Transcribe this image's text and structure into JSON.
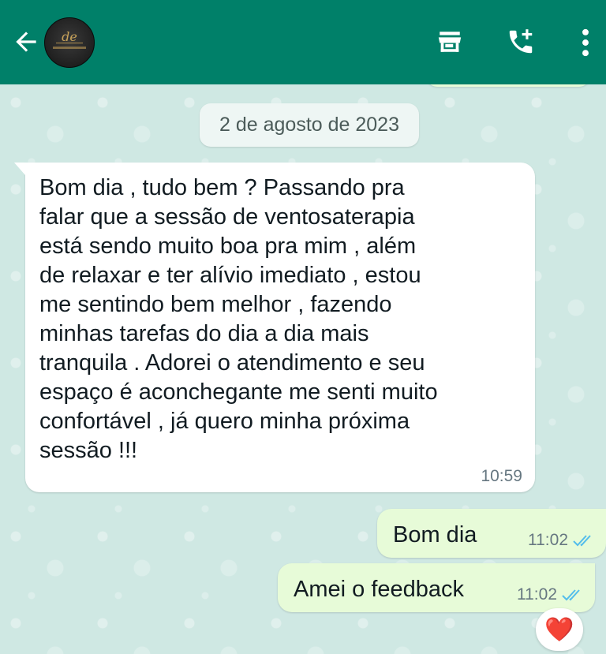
{
  "header": {
    "avatar_text": "de",
    "colors": {
      "bar": "#008069",
      "icon": "#ffffff"
    },
    "icons": [
      "back-arrow-icon",
      "store-icon",
      "add-call-icon",
      "more-vertical-icon"
    ]
  },
  "chat": {
    "date_chip": "2 de agosto de 2023",
    "incoming": {
      "text": "Bom dia , tudo bem ? Passando pra\nfalar que a sessão de ventosaterapia\nestá sendo muito boa pra mim , além\nde relaxar e ter alívio imediato , estou\nme sentindo bem melhor  , fazendo\nminhas tarefas do dia a dia mais\ntranquila . Adorei o atendimento e seu\nespaço é aconchegante  me senti muito\nconfortável , já quero minha próxima\nsessão !!!",
      "time": "10:59"
    },
    "outgoing": [
      {
        "text": "Bom dia",
        "time": "11:02",
        "status": "read"
      },
      {
        "text": "Amei o feedback",
        "time": "11:02",
        "status": "read"
      }
    ],
    "reaction": "❤️",
    "colors": {
      "outgoing_bubble": "#e7fbd8",
      "incoming_bubble": "#ffffff",
      "read_ticks": "#53bdeb"
    }
  }
}
